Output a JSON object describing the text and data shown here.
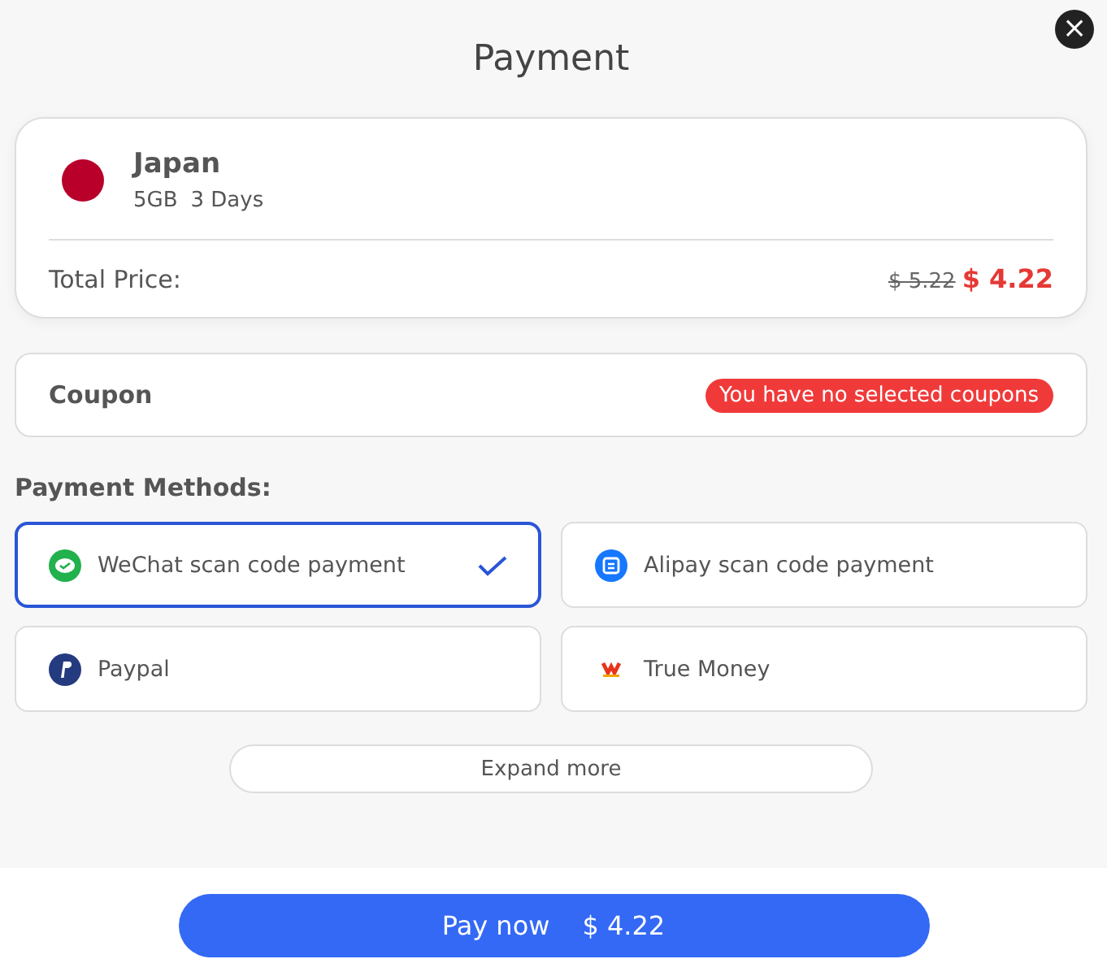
{
  "title": "Payment",
  "close": "×",
  "plan": {
    "country": "Japan",
    "data": "5GB",
    "duration": "3 Days",
    "total_label": "Total Price:",
    "old_price": "$ 5.22",
    "price": "$ 4.22"
  },
  "coupon": {
    "label": "Coupon",
    "status": "You have no selected coupons"
  },
  "payment_methods": {
    "label": "Payment Methods:",
    "items": [
      {
        "kind": "wechat",
        "name": "WeChat scan code payment",
        "selected": true
      },
      {
        "kind": "alipay",
        "name": "Alipay scan code payment",
        "selected": false
      },
      {
        "kind": "paypal",
        "name": "Paypal",
        "selected": false
      },
      {
        "kind": "truemoney",
        "name": "True Money",
        "selected": false
      }
    ]
  },
  "expand": "Expand more",
  "pay": {
    "label": "Pay now",
    "amount": "$ 4.22"
  }
}
